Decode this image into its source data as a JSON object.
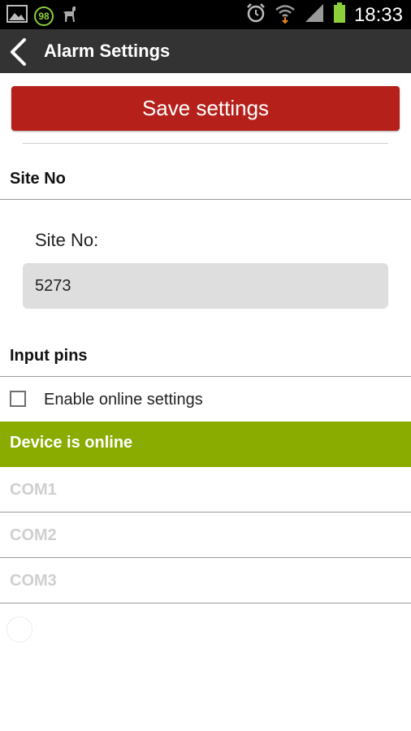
{
  "status_bar": {
    "time": "18:33",
    "badge": "98"
  },
  "action_bar": {
    "title": "Alarm Settings"
  },
  "save_button": {
    "label": "Save settings"
  },
  "site_section": {
    "title": "Site No",
    "field_label": "Site No:",
    "field_value": "5273"
  },
  "input_pins": {
    "title": "Input pins",
    "checkbox_label": "Enable online settings",
    "checkbox_checked": false
  },
  "online_banner": {
    "text": "Device is online"
  },
  "com_ports": [
    {
      "label": "COM1"
    },
    {
      "label": "COM2"
    },
    {
      "label": "COM3"
    }
  ],
  "colors": {
    "save_button": "#b5201b",
    "online_banner": "#8aab00",
    "action_bar": "#333333"
  }
}
